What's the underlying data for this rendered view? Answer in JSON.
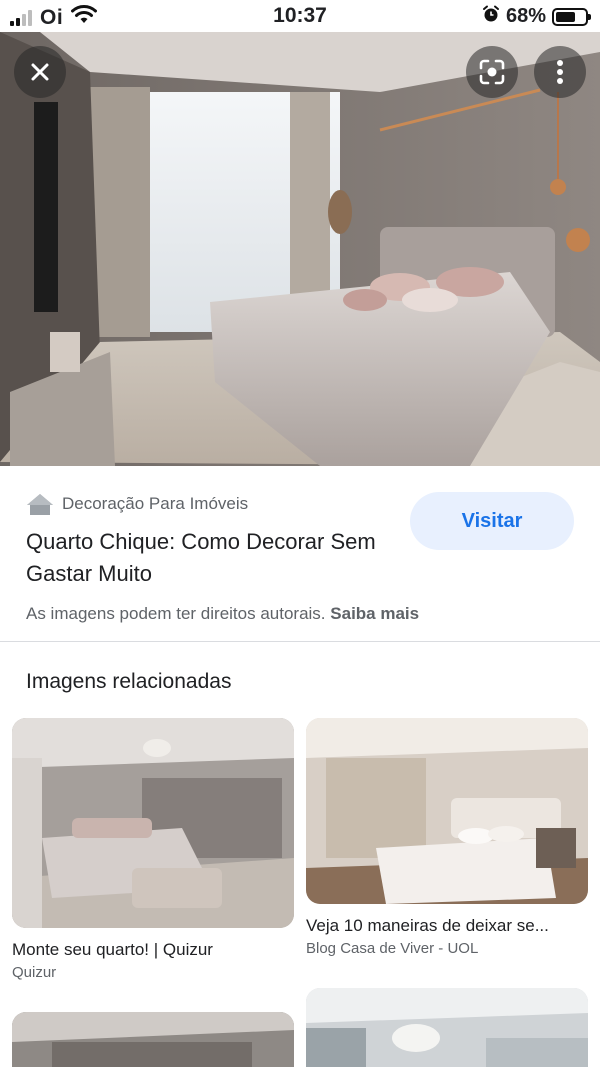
{
  "status_bar": {
    "carrier": "Oi",
    "time": "10:37",
    "battery_percent": "68%",
    "battery_level": 0.68,
    "icons": [
      "signal-icon",
      "wifi-icon",
      "alarm-icon",
      "battery-icon"
    ]
  },
  "hero": {
    "buttons": [
      "close-icon",
      "lens-icon",
      "more-vert-icon"
    ]
  },
  "result": {
    "source": "Decoração Para Imóveis",
    "source_icon": "house-icon",
    "title": "Quarto Chique: Como Decorar Sem Gastar Muito",
    "visit_label": "Visitar",
    "copyright_text": "As imagens podem ter direitos autorais.",
    "learn_more": "Saiba mais"
  },
  "related": {
    "heading": "Imagens relacionadas",
    "items": [
      {
        "title": "Monte seu quarto! | Quizur",
        "source": "Quizur"
      },
      {
        "title": "Veja 10 maneiras de deixar se...",
        "source": "Blog Casa de Viver - UOL"
      }
    ]
  },
  "colors": {
    "accent": "#1a73e8",
    "button_bg": "#e8f0fe",
    "secondary_text": "#5f6368"
  }
}
